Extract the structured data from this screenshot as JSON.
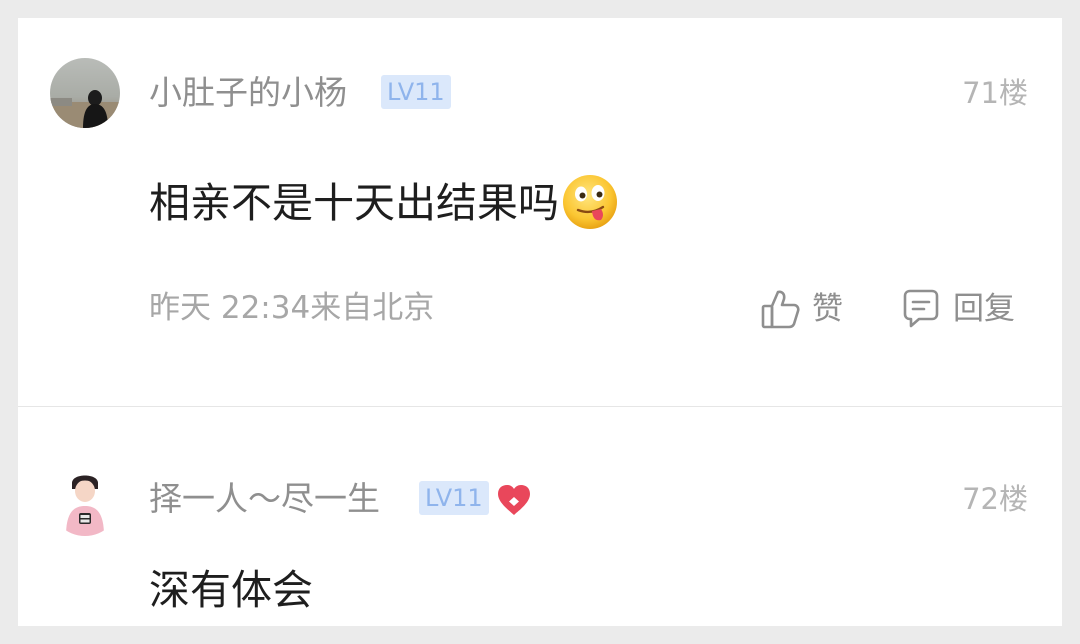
{
  "comments": [
    {
      "username": "小肚子的小杨",
      "level": "LV11",
      "floor": "71楼",
      "content": "相亲不是十天出结果吗",
      "emoji": "drooling-face-emoji",
      "meta": "昨天 22:34来自北京",
      "like_label": "赞",
      "reply_label": "回复"
    },
    {
      "username": "择一人～尽一生",
      "level": "LV11",
      "floor": "72楼",
      "content": "深有体会"
    }
  ],
  "icons": {
    "like": "thumbs-up-icon",
    "reply": "speech-bubble-icon",
    "heart": "heart-badge-icon"
  },
  "colors": {
    "level_badge_bg": "#dbe8fb",
    "level_badge_text": "#8fb4ec",
    "heart": "#e9475b",
    "username": "#8f8f8f",
    "content": "#1e1e1e"
  }
}
